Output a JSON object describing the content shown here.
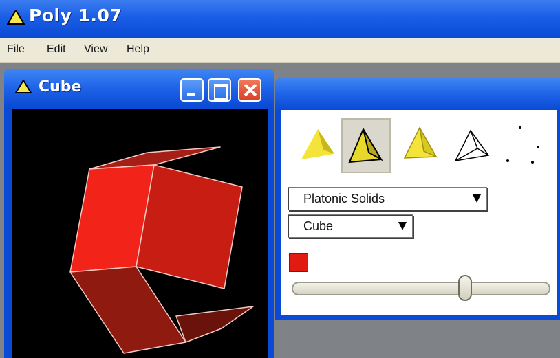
{
  "app": {
    "title": "Poly 1.07"
  },
  "menu": {
    "items": [
      "File",
      "Edit",
      "View",
      "Help"
    ]
  },
  "cube_window": {
    "title": "Cube",
    "buttons": [
      "minimize",
      "maximize",
      "close"
    ]
  },
  "controls": {
    "view_modes": [
      {
        "name": "solid-shaded-icon",
        "selected": false
      },
      {
        "name": "solid-edged-icon",
        "selected": true
      },
      {
        "name": "flat-shaded-icon",
        "selected": false
      },
      {
        "name": "wireframe-icon",
        "selected": false
      },
      {
        "name": "vertices-icon",
        "selected": false
      }
    ],
    "family_select": {
      "value": "Platonic Solids"
    },
    "solid_select": {
      "value": "Cube"
    },
    "color": "#e11b12",
    "slider_fraction": 0.68
  },
  "colors": {
    "titlebar": "#1b5ee6",
    "workspace": "#7f8287",
    "menubar": "#ece9d8",
    "polyhedron": "#e11b12",
    "viewport": "#000000"
  }
}
